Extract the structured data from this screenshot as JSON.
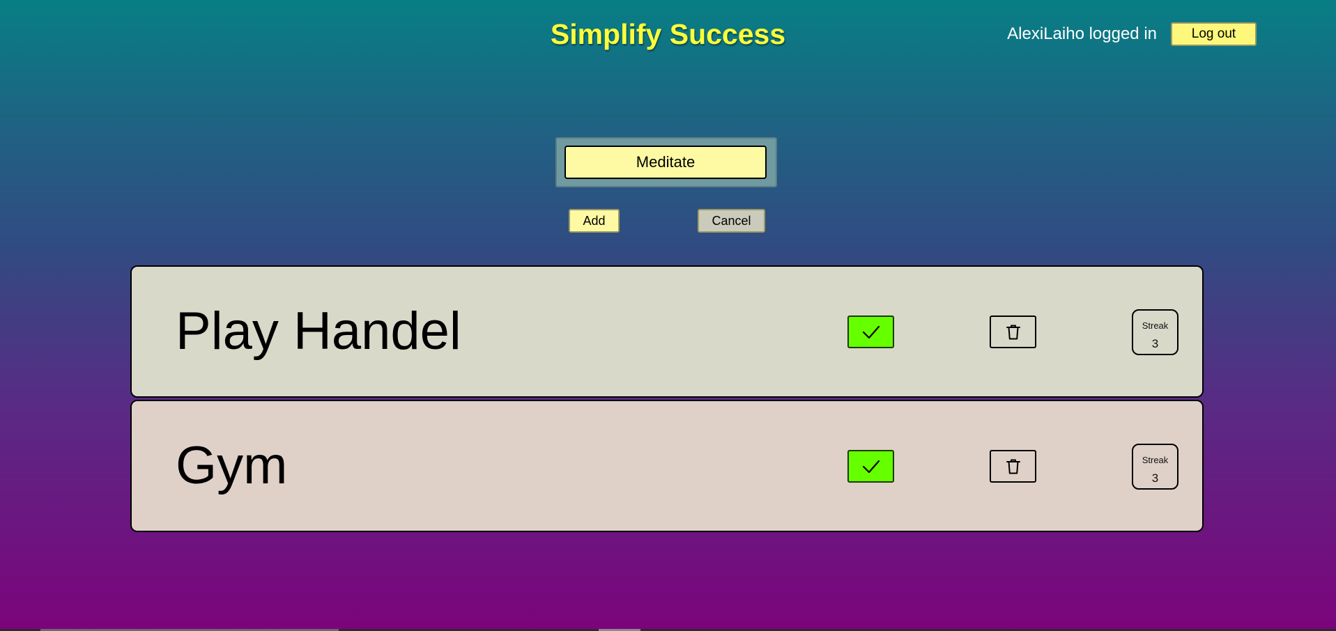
{
  "header": {
    "title": "Simplify Success",
    "user_status": "AlexiLaiho logged in",
    "logout_label": "Log out"
  },
  "new_habit": {
    "input_value": "Meditate",
    "add_label": "Add",
    "cancel_label": "Cancel"
  },
  "habits": [
    {
      "name": "Play Handel",
      "streak_label": "Streak",
      "streak": "3",
      "done_icon": "check-icon",
      "delete_icon": "trash-icon"
    },
    {
      "name": "Gym",
      "streak_label": "Streak",
      "streak": "3",
      "done_icon": "check-icon",
      "delete_icon": "trash-icon"
    }
  ],
  "colors": {
    "title": "#fdfe3a",
    "button_yellow": "#fdfaa3",
    "done_green": "#66ff00",
    "card_1": "#d8d9c9",
    "card_2": "#e0d1c8",
    "background_top": "#077f84",
    "background_bottom": "#7c037c"
  }
}
